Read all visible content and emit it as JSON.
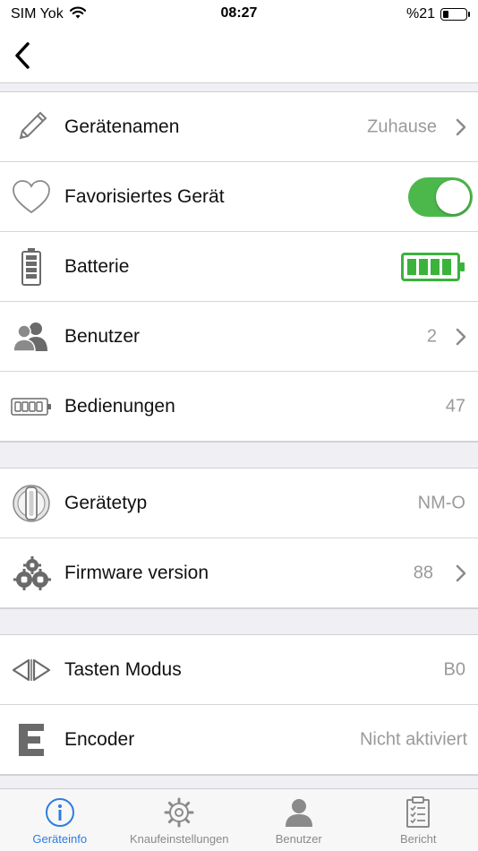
{
  "status_bar": {
    "carrier": "SIM Yok",
    "time": "08:27",
    "battery_text": "%21"
  },
  "nav": {
    "back_icon": "chevron-left-icon"
  },
  "rows": {
    "device_name": {
      "label": "Gerätenamen",
      "value": "Zuhause",
      "icon": "pencil-icon"
    },
    "favorite": {
      "label": "Favorisiertes Gerät",
      "toggle_on": true,
      "icon": "heart-icon",
      "toggle_color": "#4cb84c"
    },
    "battery": {
      "label": "Batterie",
      "level_fraction": 1.0,
      "icon": "battery-icon",
      "level_color": "#3bb33b"
    },
    "users": {
      "label": "Benutzer",
      "value": "2",
      "icon": "users-icon"
    },
    "operations": {
      "label": "Bedienungen",
      "value": "47",
      "icon": "counter-icon"
    },
    "device_type": {
      "label": "Gerätetyp",
      "value": "NM-O",
      "icon": "knob-icon"
    },
    "firmware": {
      "label": "Firmware version",
      "value": "88",
      "icon": "gears-icon"
    },
    "button_mode": {
      "label": "Tasten Modus",
      "value": "B0",
      "icon": "arrows-icon"
    },
    "encoder": {
      "label": "Encoder",
      "value": "Nicht aktiviert",
      "icon": "encoder-e-icon"
    }
  },
  "tabs": [
    {
      "label": "Geräteinfo",
      "icon": "info-icon",
      "active": true
    },
    {
      "label": "Knaufeinstellungen",
      "icon": "gear-icon",
      "active": false
    },
    {
      "label": "Benutzer",
      "icon": "user-icon",
      "active": false
    },
    {
      "label": "Bericht",
      "icon": "clipboard-icon",
      "active": false
    }
  ],
  "colors": {
    "accent": "#2d7ce0",
    "success": "#4cb84c",
    "muted_text": "#9a9a9a",
    "group_bg": "#efeff4"
  }
}
